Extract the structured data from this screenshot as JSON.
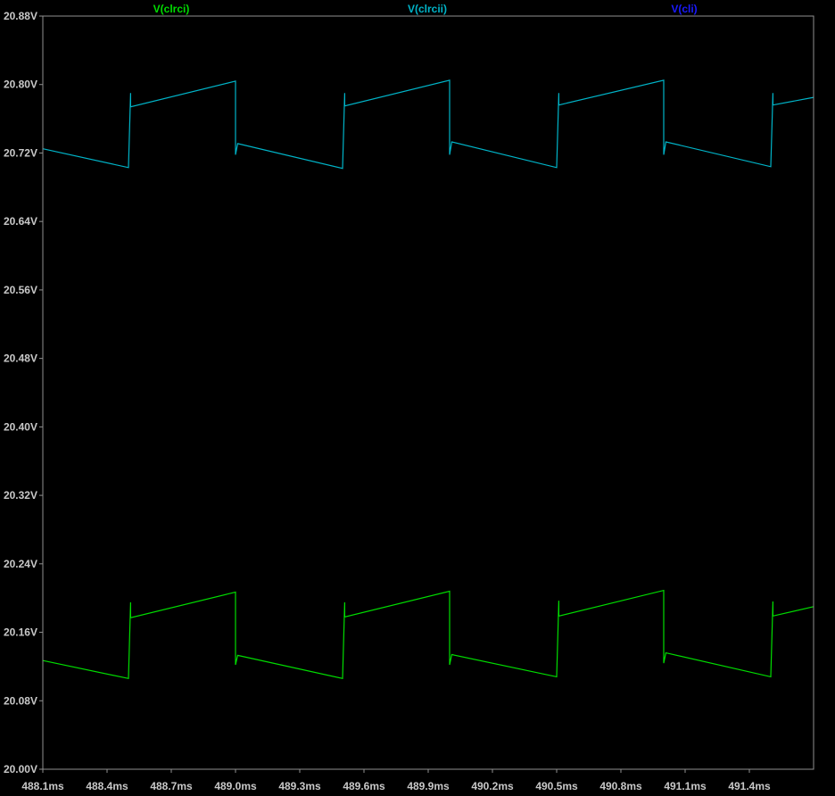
{
  "chart_data": {
    "type": "line",
    "title": "",
    "xlabel": "",
    "ylabel": "",
    "grid": false,
    "legend_placement": "top",
    "colors": {
      "background": "#000000",
      "frame": "#909090",
      "tick_text": "#c8c8c8"
    },
    "xlim": [
      488.1,
      491.7
    ],
    "ylim": [
      20.0,
      20.88
    ],
    "x_ticks": [
      488.1,
      488.4,
      488.7,
      489.0,
      489.3,
      489.6,
      489.9,
      490.2,
      490.5,
      490.8,
      491.1,
      491.4
    ],
    "x_tick_labels": [
      "488.1ms",
      "488.4ms",
      "488.7ms",
      "489.0ms",
      "489.3ms",
      "489.6ms",
      "489.9ms",
      "490.2ms",
      "490.5ms",
      "490.8ms",
      "491.1ms",
      "491.4ms"
    ],
    "y_ticks": [
      20.88,
      20.8,
      20.72,
      20.64,
      20.56,
      20.48,
      20.4,
      20.32,
      20.24,
      20.16,
      20.08,
      20.0
    ],
    "y_tick_labels": [
      "20.88V",
      "20.80V",
      "20.72V",
      "20.64V",
      "20.56V",
      "20.48V",
      "20.40V",
      "20.32V",
      "20.24V",
      "20.16V",
      "20.08V",
      "20.00V"
    ],
    "series": [
      {
        "name": "V(clrci)",
        "color": "#00dd00",
        "x": [
          488.1,
          488.5,
          488.51,
          488.51,
          489.0,
          489.0,
          489.01,
          489.5,
          489.51,
          489.51,
          490.0,
          490.0,
          490.01,
          490.5,
          490.51,
          490.51,
          491.0,
          491.0,
          491.01,
          491.5,
          491.51,
          491.51,
          491.7
        ],
        "y": [
          20.127,
          20.106,
          20.195,
          20.177,
          20.207,
          20.122,
          20.133,
          20.106,
          20.195,
          20.178,
          20.208,
          20.122,
          20.134,
          20.108,
          20.197,
          20.179,
          20.209,
          20.124,
          20.136,
          20.108,
          20.196,
          20.179,
          20.19
        ]
      },
      {
        "name": "V(clrcii)",
        "color": "#00b4c8",
        "x": [
          488.1,
          488.5,
          488.51,
          488.51,
          489.0,
          489.0,
          489.01,
          489.5,
          489.51,
          489.51,
          490.0,
          490.0,
          490.01,
          490.5,
          490.51,
          490.51,
          491.0,
          491.0,
          491.01,
          491.5,
          491.51,
          491.51,
          491.7
        ],
        "y": [
          20.725,
          20.703,
          20.79,
          20.774,
          20.804,
          20.718,
          20.731,
          20.702,
          20.79,
          20.775,
          20.805,
          20.718,
          20.733,
          20.703,
          20.79,
          20.776,
          20.805,
          20.718,
          20.733,
          20.704,
          20.79,
          20.776,
          20.785
        ]
      },
      {
        "name": "V(cli)",
        "color": "#1a1aff",
        "x": [],
        "y": []
      }
    ]
  }
}
